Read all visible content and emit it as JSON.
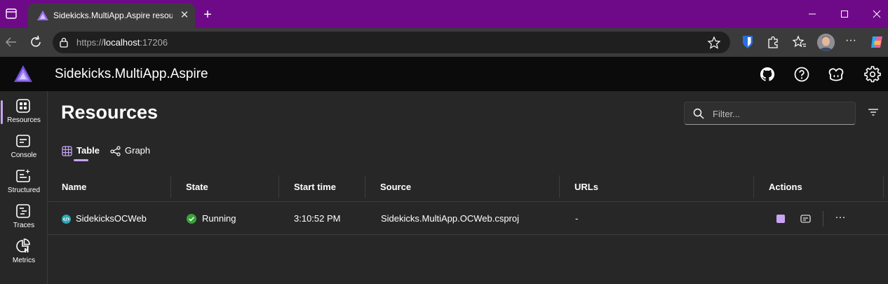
{
  "browser": {
    "tab_title": "Sidekicks.MultiApp.Aspire resources",
    "tab_close": "✕",
    "new_tab": "+",
    "url_scheme": "https://",
    "url_host": "localhost",
    "url_port": ":17206",
    "more": "···",
    "theme_color": "#6e0a88"
  },
  "app": {
    "title": "Sidekicks.MultiApp.Aspire",
    "accent": "#c6a4f5"
  },
  "nav": [
    {
      "label": "Resources",
      "icon": "resources-icon"
    },
    {
      "label": "Console",
      "icon": "console-icon"
    },
    {
      "label": "Structured",
      "icon": "structured-icon"
    },
    {
      "label": "Traces",
      "icon": "traces-icon"
    },
    {
      "label": "Metrics",
      "icon": "metrics-icon"
    }
  ],
  "main": {
    "title": "Resources",
    "filter_placeholder": "Filter...",
    "tabs": [
      {
        "label": "Table"
      },
      {
        "label": "Graph"
      }
    ]
  },
  "grid": {
    "columns": [
      "Name",
      "State",
      "Start time",
      "Source",
      "URLs",
      "Actions"
    ],
    "rows": [
      {
        "name": "SidekicksOCWeb",
        "state": "Running",
        "start_time": "3:10:52 PM",
        "source": "Sidekicks.MultiApp.OCWeb.csproj",
        "urls": "-",
        "more": "···"
      }
    ]
  }
}
